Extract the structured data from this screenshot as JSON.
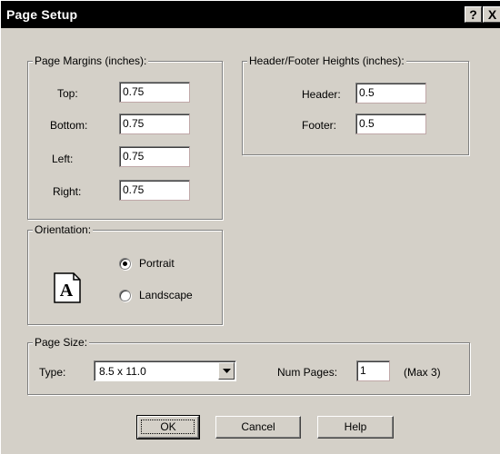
{
  "window": {
    "title": "Page Setup",
    "help_glyph": "?",
    "close_glyph": "X"
  },
  "margins": {
    "legend": "Page Margins (inches):",
    "top_label": "Top:",
    "top_value": "0.75",
    "bottom_label": "Bottom:",
    "bottom_value": "0.75",
    "left_label": "Left:",
    "left_value": "0.75",
    "right_label": "Right:",
    "right_value": "0.75"
  },
  "header_footer": {
    "legend": "Header/Footer Heights (inches):",
    "header_label": "Header:",
    "header_value": "0.5",
    "footer_label": "Footer:",
    "footer_value": "0.5"
  },
  "orientation": {
    "legend": "Orientation:",
    "icon_letter": "A",
    "icon": "page-portrait-icon",
    "options": [
      {
        "label": "Portrait",
        "selected": true
      },
      {
        "label": "Landscape",
        "selected": false
      }
    ]
  },
  "page_size": {
    "legend": "Page Size:",
    "type_label": "Type:",
    "type_value": "8.5 x 11.0",
    "num_pages_label": "Num Pages:",
    "num_pages_value": "1",
    "max_note": "(Max 3)"
  },
  "buttons": {
    "ok": "OK",
    "cancel": "Cancel",
    "help": "Help"
  },
  "colors": {
    "face": "#d4d0c8",
    "titlebar": "#000000"
  }
}
